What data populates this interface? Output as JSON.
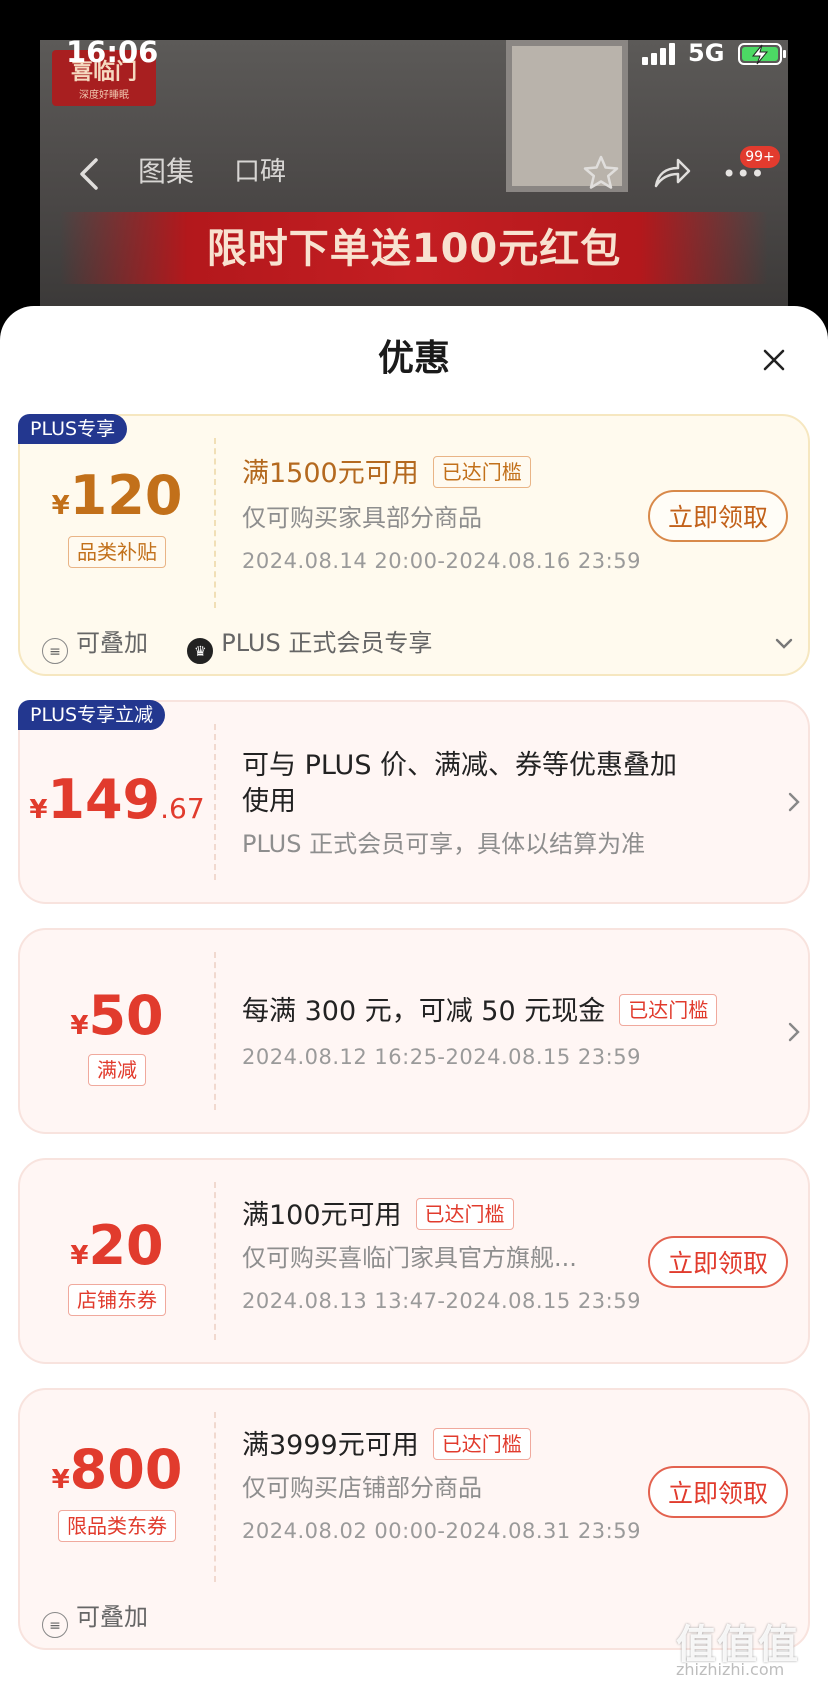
{
  "status_bar": {
    "time": "16:06",
    "network": "5G"
  },
  "background": {
    "logo_text": "喜临门",
    "logo_sub": "深度好睡眠",
    "banner": "限时下单送100元红包"
  },
  "nav": {
    "tab_gallery": "图集",
    "tab_reviews": "口碑",
    "badge": "99+"
  },
  "sheet": {
    "title": "优惠"
  },
  "coupons": [
    {
      "tag": "PLUS专享",
      "currency": "¥",
      "amount": "120",
      "amount_dec": "",
      "chip": "品类补贴",
      "main": "满1500元可用",
      "reached": "已达门槛",
      "sub": "仅可购买家具部分商品",
      "date": "2024.08.14 20:00-2024.08.16 23:59",
      "button": "立即领取",
      "footer": [
        {
          "icon": "stack-icon",
          "label": "可叠加"
        },
        {
          "icon": "crown-icon",
          "label": "PLUS 正式会员专享"
        }
      ]
    },
    {
      "tag": "PLUS专享立减",
      "currency": "¥",
      "amount": "149",
      "amount_dec": ".67",
      "main_line1": "可与 PLUS 价、满减、券等优惠叠加",
      "main_line2": "使用",
      "sub": "PLUS 正式会员可享，具体以结算为准"
    },
    {
      "currency": "¥",
      "amount": "50",
      "chip": "满减",
      "main": "每满 300 元，可减 50 元现金",
      "reached": "已达门槛",
      "date": "2024.08.12 16:25-2024.08.15 23:59"
    },
    {
      "currency": "¥",
      "amount": "20",
      "chip": "店铺东券",
      "main": "满100元可用",
      "reached": "已达门槛",
      "sub": "仅可购买喜临门家具官方旗舰...",
      "date": "2024.08.13 13:47-2024.08.15 23:59",
      "button": "立即领取"
    },
    {
      "currency": "¥",
      "amount": "800",
      "chip": "限品类东券",
      "main": "满3999元可用",
      "reached": "已达门槛",
      "sub": "仅可购买店铺部分商品",
      "date": "2024.08.02 00:00-2024.08.31 23:59",
      "button": "立即领取",
      "footer": [
        {
          "icon": "stack-icon",
          "label": "可叠加"
        }
      ]
    }
  ],
  "watermark": {
    "text": "值值值",
    "url": "zhizhizhi.com"
  },
  "colors": {
    "accent_red": "#e13b2d",
    "plus_blue": "#23378f",
    "gold": "#c2701a"
  }
}
